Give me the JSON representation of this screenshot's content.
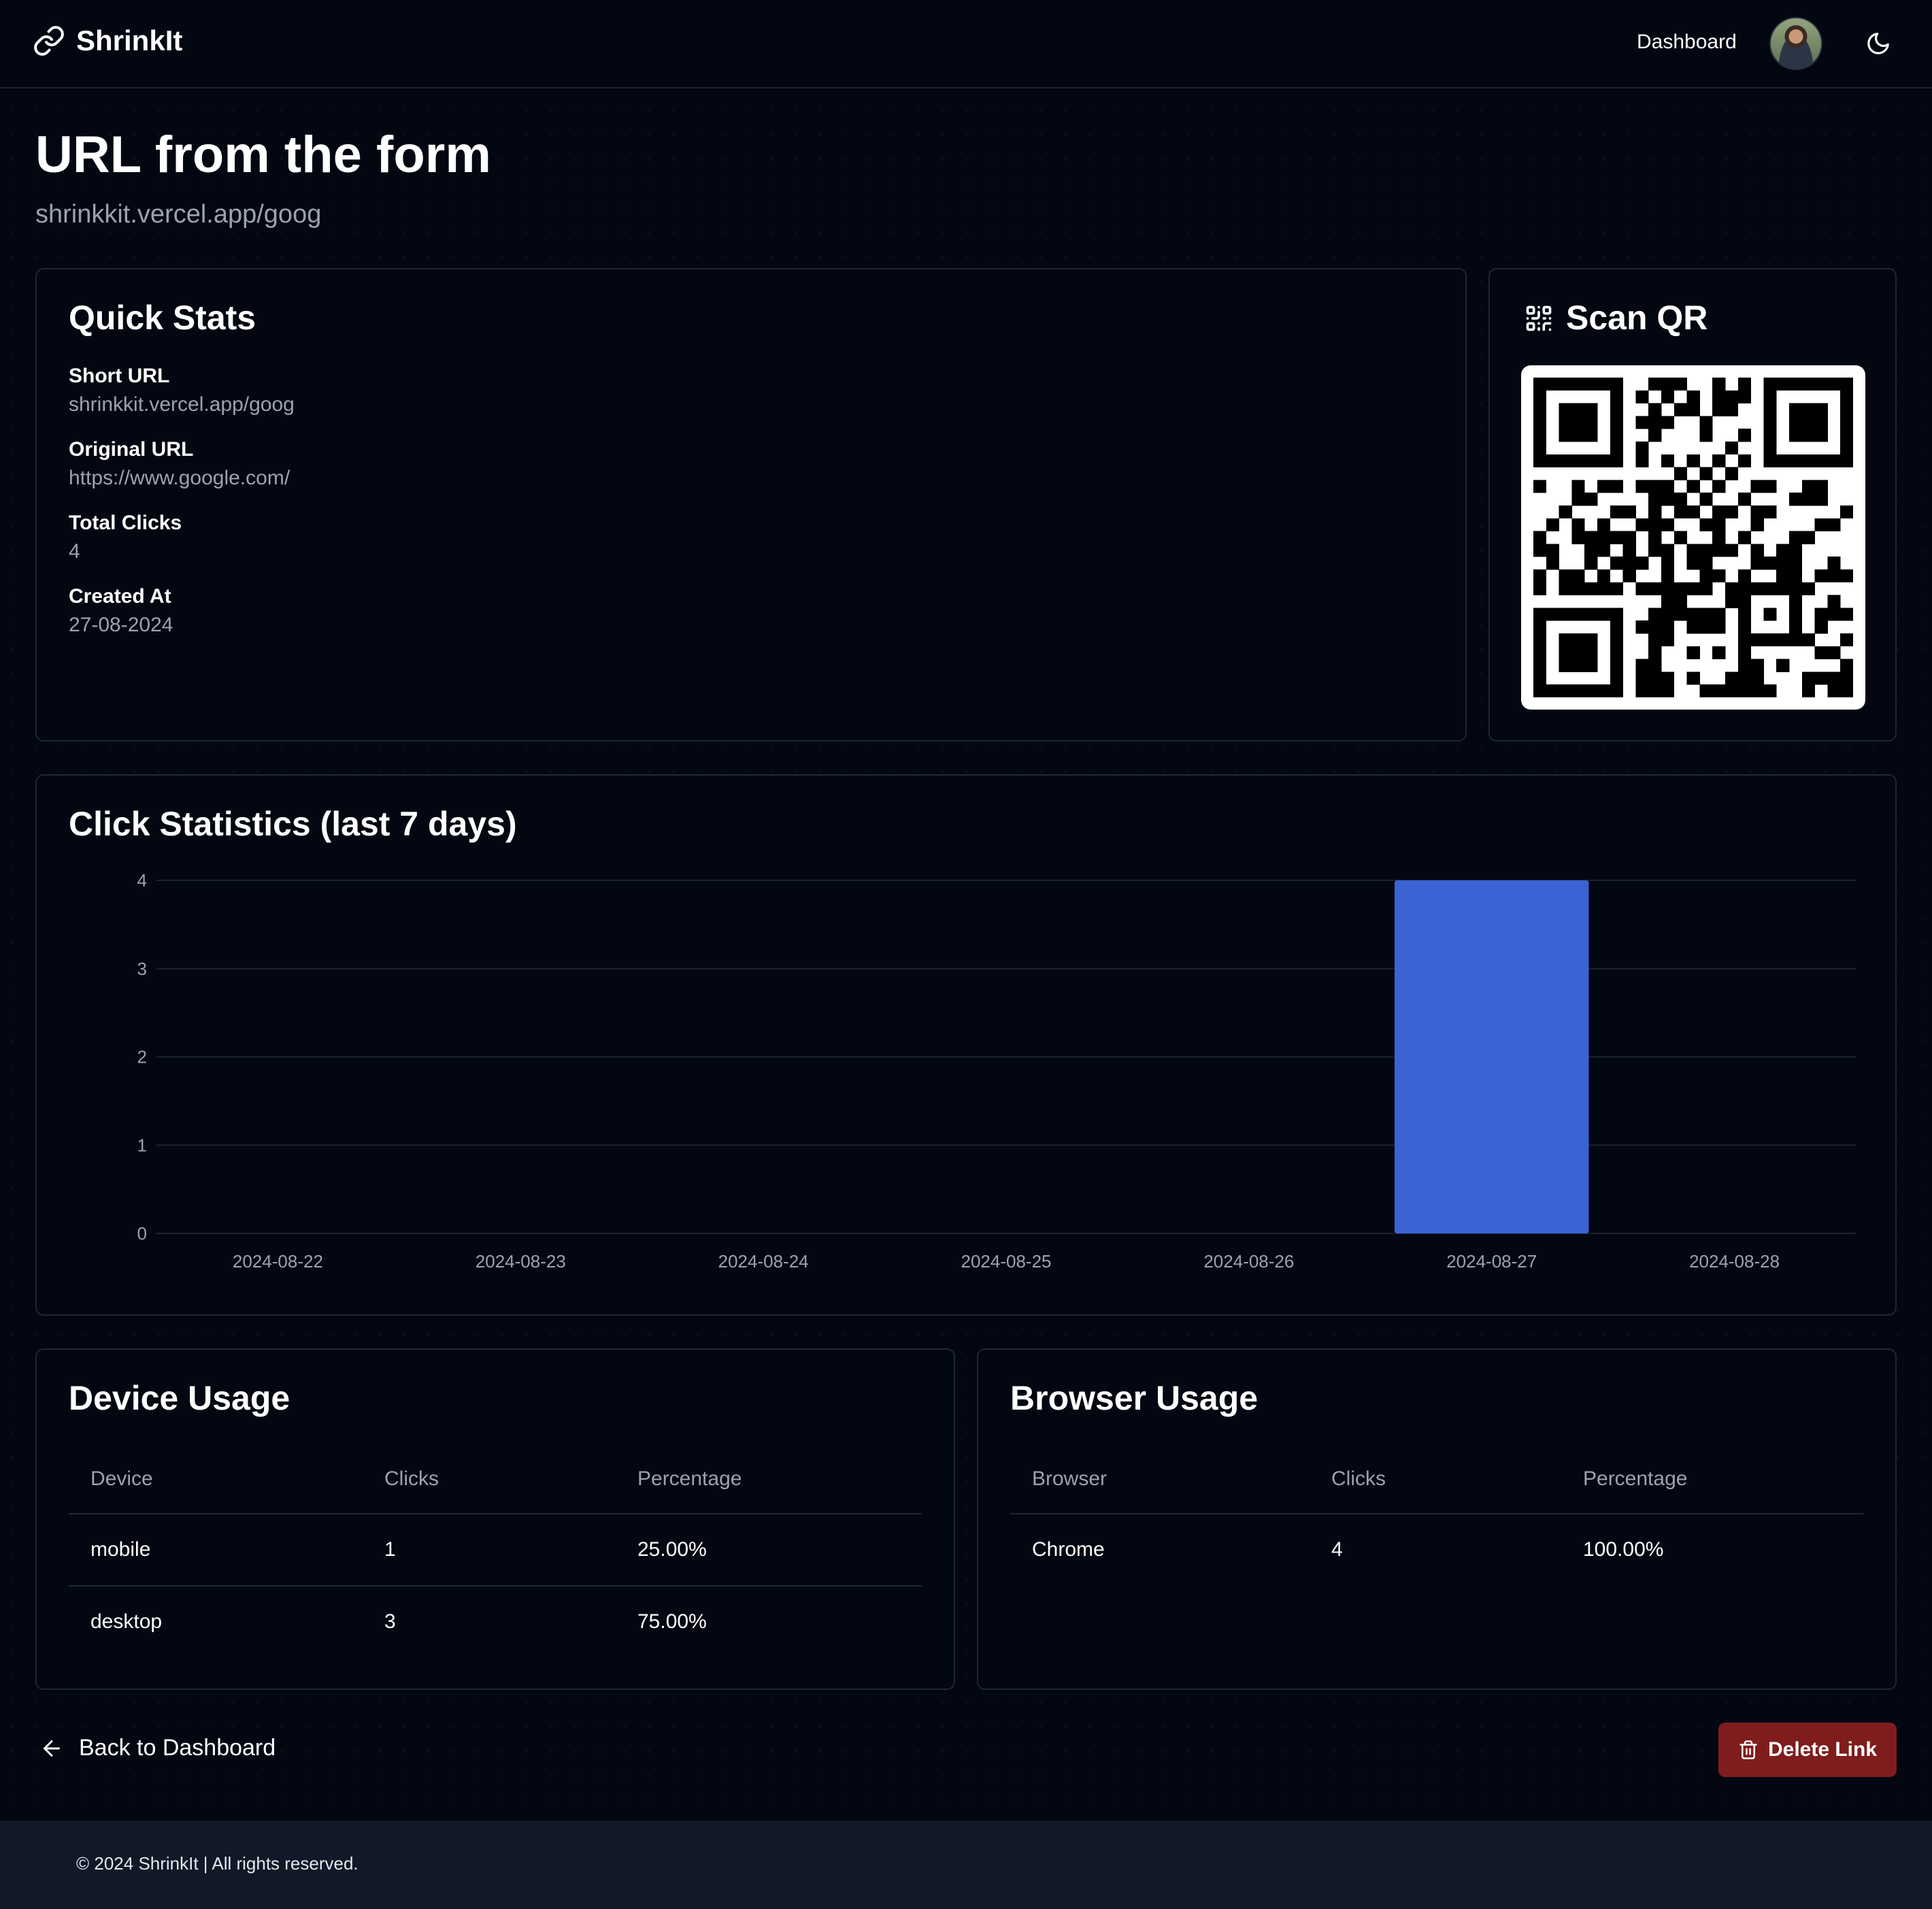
{
  "app": {
    "name": "ShrinkIt"
  },
  "nav": {
    "dashboard": "Dashboard",
    "icons": [
      "link-icon",
      "moon-icon"
    ]
  },
  "page": {
    "title": "URL from the form",
    "subtitle": "shrinkkit.vercel.app/goog"
  },
  "quick_stats": {
    "title": "Quick Stats",
    "items": [
      {
        "label": "Short URL",
        "value": "shrinkkit.vercel.app/goog"
      },
      {
        "label": "Original URL",
        "value": "https://www.google.com/"
      },
      {
        "label": "Total Clicks",
        "value": "4"
      },
      {
        "label": "Created At",
        "value": "27-08-2024"
      }
    ]
  },
  "qr": {
    "title": "Scan QR",
    "icon": "qr-code-icon"
  },
  "click_stats": {
    "title": "Click Statistics (last 7 days)"
  },
  "chart_data": {
    "type": "bar",
    "title": "Click Statistics (last 7 days)",
    "categories": [
      "2024-08-22",
      "2024-08-23",
      "2024-08-24",
      "2024-08-25",
      "2024-08-26",
      "2024-08-27",
      "2024-08-28"
    ],
    "values": [
      0,
      0,
      0,
      0,
      0,
      4,
      0
    ],
    "ylim": [
      0,
      4
    ],
    "yticks": [
      "0",
      "1",
      "2",
      "3",
      "4"
    ],
    "grid": true,
    "bar_color": "#3b63d4"
  },
  "device_usage": {
    "title": "Device Usage",
    "headers": [
      "Device",
      "Clicks",
      "Percentage"
    ],
    "rows": [
      [
        "mobile",
        "1",
        "25.00%"
      ],
      [
        "desktop",
        "3",
        "75.00%"
      ]
    ]
  },
  "browser_usage": {
    "title": "Browser Usage",
    "headers": [
      "Browser",
      "Clicks",
      "Percentage"
    ],
    "rows": [
      [
        "Chrome",
        "4",
        "100.00%"
      ]
    ]
  },
  "actions": {
    "back": "Back to Dashboard",
    "delete": "Delete Link"
  },
  "footer": {
    "text": "© 2024 ShrinkIt | All rights reserved."
  },
  "colors": {
    "background": "#030712",
    "accent": "#3b63d4",
    "danger": "#7f1d1d",
    "footer": "#111827"
  }
}
